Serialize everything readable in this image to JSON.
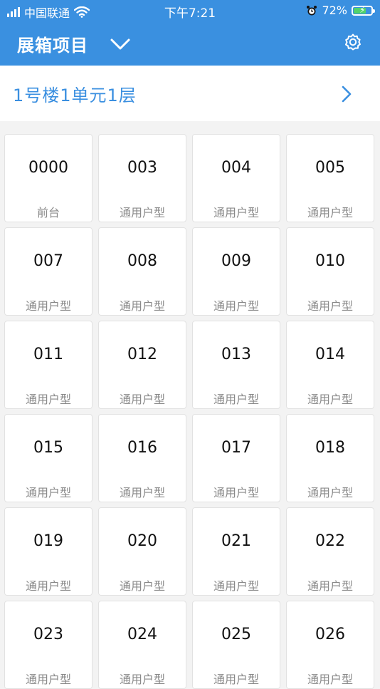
{
  "status": {
    "carrier": "中国联通",
    "time": "下午7:21",
    "battery": "72%",
    "battery_level": 72
  },
  "header": {
    "title": "展箱项目",
    "dropdown_icon": "chevron-down-icon",
    "settings_icon": "gear-icon",
    "color": "#3a90e0"
  },
  "breadcrumb": {
    "label": "1号楼1单元1层",
    "arrow_icon": "chevron-right-icon",
    "color": "#3a8fe0"
  },
  "units": [
    {
      "number": "0000",
      "type": "前台"
    },
    {
      "number": "003",
      "type": "通用户型"
    },
    {
      "number": "004",
      "type": "通用户型"
    },
    {
      "number": "005",
      "type": "通用户型"
    },
    {
      "number": "007",
      "type": "通用户型"
    },
    {
      "number": "008",
      "type": "通用户型"
    },
    {
      "number": "009",
      "type": "通用户型"
    },
    {
      "number": "010",
      "type": "通用户型"
    },
    {
      "number": "011",
      "type": "通用户型"
    },
    {
      "number": "012",
      "type": "通用户型"
    },
    {
      "number": "013",
      "type": "通用户型"
    },
    {
      "number": "014",
      "type": "通用户型"
    },
    {
      "number": "015",
      "type": "通用户型"
    },
    {
      "number": "016",
      "type": "通用户型"
    },
    {
      "number": "017",
      "type": "通用户型"
    },
    {
      "number": "018",
      "type": "通用户型"
    },
    {
      "number": "019",
      "type": "通用户型"
    },
    {
      "number": "020",
      "type": "通用户型"
    },
    {
      "number": "021",
      "type": "通用户型"
    },
    {
      "number": "022",
      "type": "通用户型"
    },
    {
      "number": "023",
      "type": "通用户型"
    },
    {
      "number": "024",
      "type": "通用户型"
    },
    {
      "number": "025",
      "type": "通用户型"
    },
    {
      "number": "026",
      "type": "通用户型"
    }
  ]
}
